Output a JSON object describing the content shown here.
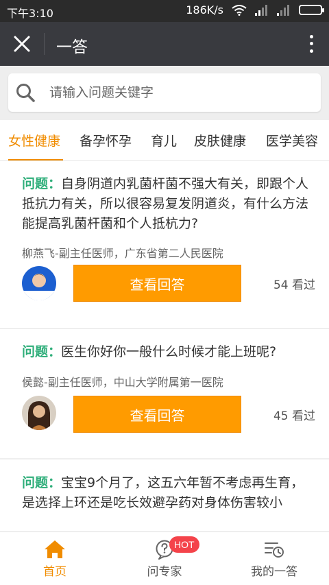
{
  "status_bar": {
    "time": "下午3:10",
    "network_speed": "186K/s"
  },
  "nav": {
    "title": "一答",
    "close_icon": "close-icon",
    "more_icon": "more-vertical-icon"
  },
  "search": {
    "placeholder": "请输入问题关键字",
    "value": ""
  },
  "tabs": [
    {
      "label": "女性健康",
      "active": true
    },
    {
      "label": "备孕怀孕",
      "active": false
    },
    {
      "label": "育儿",
      "active": false
    },
    {
      "label": "皮肤健康",
      "active": false
    },
    {
      "label": "医学美容",
      "active": false
    }
  ],
  "questions": [
    {
      "label": "问题：",
      "text": "自身阴道内乳菌杆菌不强大有关，即跟个人抵抗力有关，所以很容易复发阴道炎，有什么方法能提高乳菌杆菌和个人抵杭力?",
      "doctor": "柳燕飞-副主任医师，广东省第二人民医院",
      "button": "查看回答",
      "views": "54 看过"
    },
    {
      "label": "问题：",
      "text": "医生你好你一般什么时候才能上班呢?",
      "doctor": "侯懿-副主任医师，中山大学附属第一医院",
      "button": "查看回答",
      "views": "45 看过"
    },
    {
      "label": "问题：",
      "text": "宝宝9个月了，这五六年暂不考虑再生育，是选择上环还是吃长效避孕药对身体伤害较小",
      "doctor": "",
      "button": "",
      "views": ""
    }
  ],
  "bottom_nav": [
    {
      "label": "首页",
      "icon": "home-icon",
      "active": true
    },
    {
      "label": "问专家",
      "icon": "question-icon",
      "badge": "HOT",
      "active": false
    },
    {
      "label": "我的一答",
      "icon": "history-list-icon",
      "active": false
    }
  ],
  "colors": {
    "accent": "#f08c00",
    "button": "#ff9b00",
    "question_label": "#2fae7a",
    "hot_badge": "#f4434a",
    "nav_bar": "#393a3f"
  }
}
